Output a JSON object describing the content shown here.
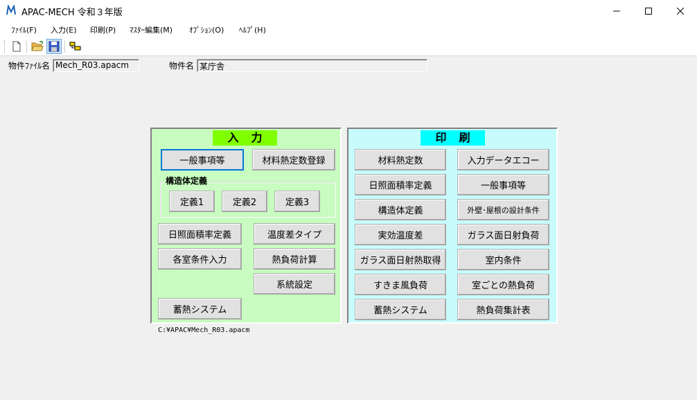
{
  "window": {
    "title": "APAC-MECH 令和３年版",
    "minimize_icon": "minimize-icon",
    "maximize_icon": "maximize-icon",
    "close_icon": "close-icon"
  },
  "menu": [
    {
      "label": "ﾌｧｲﾙ(F)"
    },
    {
      "label": "入力(E)"
    },
    {
      "label": "印刷(P)"
    },
    {
      "label": "ﾏｽﾀｰ編集(M)"
    },
    {
      "label": "ｵﾌﾟｼｮﾝ(O)"
    },
    {
      "label": "ﾍﾙﾌﾟ(H)"
    }
  ],
  "toolbar": {
    "icons": [
      "new-file-icon",
      "open-folder-icon",
      "save-disk-icon",
      "tool-icon"
    ]
  },
  "info": {
    "file_label": "物件ﾌｧｲﾙ名",
    "file_value": "Mech_R03.apacm",
    "name_label": "物件名",
    "name_value": "某庁舎"
  },
  "input_panel": {
    "title": "入力",
    "title_color": "#80ff00",
    "bg_color": "#c8fcc0",
    "general": "一般事項等",
    "material": "材料熱定数登録",
    "structure_group": "構造体定義",
    "def1": "定義1",
    "def2": "定義2",
    "def3": "定義3",
    "sunlit": "日照面積率定義",
    "temp_type": "温度差タイプ",
    "room_cond": "各室条件入力",
    "heat_calc": "熱負荷計算",
    "system_set": "系統設定",
    "thermal_storage": "蓄熱システム"
  },
  "print_panel": {
    "title": "印刷",
    "title_color": "#00ffff",
    "bg_color": "#c8fcfc",
    "left": [
      "材料熱定数",
      "日照面積率定義",
      "構造体定義",
      "実効温度差",
      "ガラス面日射熱取得",
      "すきま風負荷",
      "蓄熱システム"
    ],
    "right": [
      "入力データエコー",
      "一般事項等",
      "外壁･屋根の設計条件",
      "ガラス面日射負荷",
      "室内条件",
      "室ごとの熱負荷",
      "熱負荷集計表"
    ]
  },
  "status": {
    "path": "C:¥APAC¥Mech_R03.apacm"
  }
}
